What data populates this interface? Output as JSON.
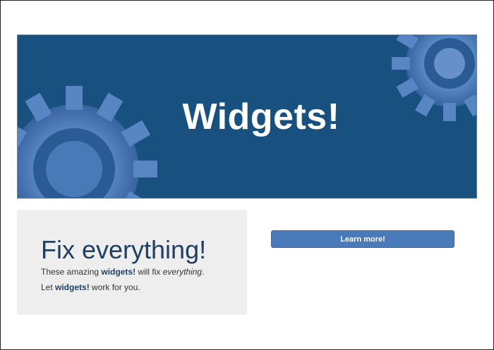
{
  "banner": {
    "title": "Widgets!",
    "background_color": "#18507f",
    "gear_color": "#5d8ac8",
    "decoration_icon": "gear-icon"
  },
  "card": {
    "heading": "Fix everything!",
    "line1": {
      "pre": "These amazing ",
      "bold": "widgets!",
      "mid": " will fix ",
      "italic": "everything",
      "post": "."
    },
    "line2": {
      "pre": "Let ",
      "bold": "widgets!",
      "post": " work for you."
    }
  },
  "cta": {
    "label": "Learn more!",
    "color": "#4a7ab9"
  }
}
